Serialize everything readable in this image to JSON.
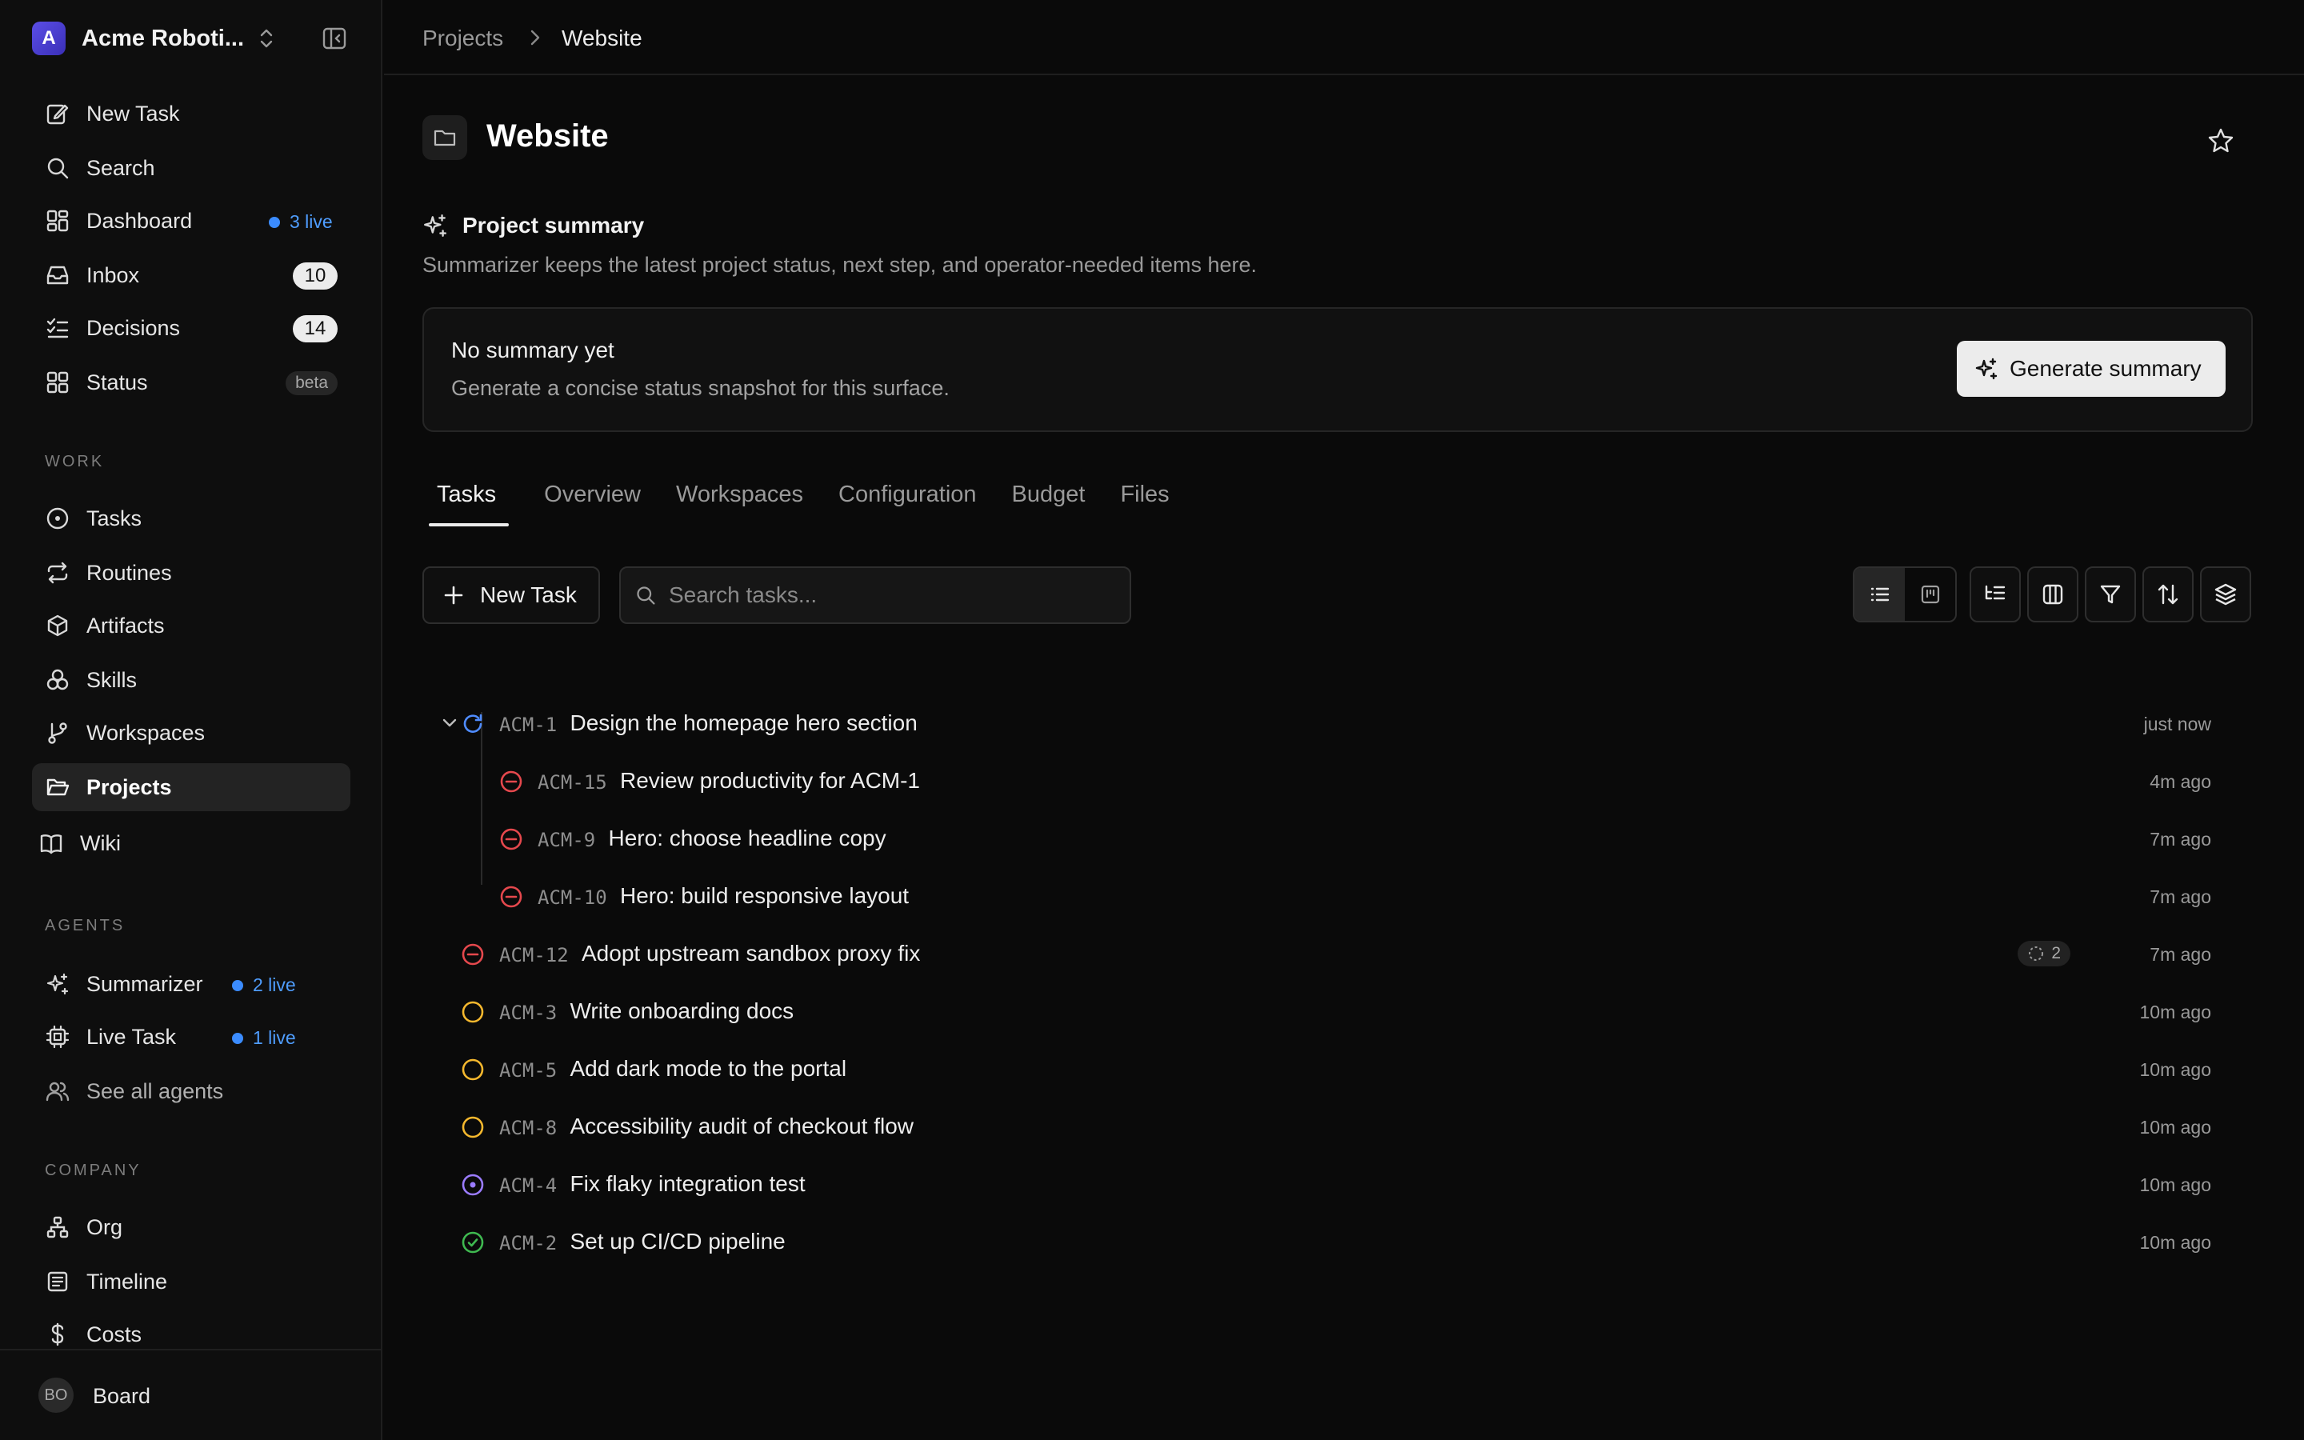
{
  "sidebar": {
    "org_initial": "A",
    "org_name": "Acme Roboti...",
    "items_top": [
      {
        "label": "New Task",
        "icon": "edit-icon"
      },
      {
        "label": "Search",
        "icon": "search-icon"
      },
      {
        "label": "Dashboard",
        "icon": "dashboard-icon",
        "live": "3 live"
      },
      {
        "label": "Inbox",
        "icon": "inbox-icon",
        "count": "10"
      },
      {
        "label": "Decisions",
        "icon": "checklist-icon",
        "count": "14"
      },
      {
        "label": "Status",
        "icon": "grid-icon",
        "tag": "beta"
      }
    ],
    "work_label": "WORK",
    "work_items": [
      {
        "label": "Tasks",
        "icon": "circle-dot-icon"
      },
      {
        "label": "Routines",
        "icon": "repeat-icon"
      },
      {
        "label": "Artifacts",
        "icon": "box-icon"
      },
      {
        "label": "Skills",
        "icon": "skills-icon"
      },
      {
        "label": "Workspaces",
        "icon": "git-branch-icon"
      },
      {
        "label": "Projects",
        "icon": "folder-open-icon",
        "active": true
      },
      {
        "label": "Wiki",
        "icon": "book-icon"
      }
    ],
    "agents_label": "AGENTS",
    "agent_items": [
      {
        "label": "Summarizer",
        "icon": "sparkles-icon",
        "live": "2 live"
      },
      {
        "label": "Live Task",
        "icon": "cpu-icon",
        "live": "1 live"
      },
      {
        "label": "See all agents",
        "icon": "users-icon"
      }
    ],
    "company_label": "COMPANY",
    "company_items": [
      {
        "label": "Org",
        "icon": "org-chart-icon"
      },
      {
        "label": "Timeline",
        "icon": "timeline-icon"
      },
      {
        "label": "Costs",
        "icon": "dollar-icon"
      }
    ],
    "user_initials": "BO",
    "user_label": "Board"
  },
  "breadcrumb": {
    "parent": "Projects",
    "current": "Website"
  },
  "page": {
    "title": "Website",
    "summary_title": "Project summary",
    "summary_desc": "Summarizer keeps the latest project status, next step, and operator-needed items here.",
    "card_heading": "No summary yet",
    "card_sub": "Generate a concise status snapshot for this surface.",
    "generate_label": "Generate summary"
  },
  "tabs": [
    "Tasks",
    "Overview",
    "Workspaces",
    "Configuration",
    "Budget",
    "Files"
  ],
  "active_tab": "Tasks",
  "toolbar": {
    "new_task_label": "New Task",
    "search_placeholder": "Search tasks..."
  },
  "tasks": [
    {
      "id": "ACM-1",
      "title": "Design the homepage hero section",
      "time": "just now",
      "status": "in-progress",
      "expanded": true
    },
    {
      "id": "ACM-15",
      "title": "Review productivity for ACM-1",
      "time": "4m ago",
      "status": "blocked",
      "child": true
    },
    {
      "id": "ACM-9",
      "title": "Hero: choose headline copy",
      "time": "7m ago",
      "status": "blocked",
      "child": true
    },
    {
      "id": "ACM-10",
      "title": "Hero: build responsive layout",
      "time": "7m ago",
      "status": "blocked",
      "child": true
    },
    {
      "id": "ACM-12",
      "title": "Adopt upstream sandbox proxy fix",
      "time": "7m ago",
      "status": "blocked",
      "chip": "2"
    },
    {
      "id": "ACM-3",
      "title": "Write onboarding docs",
      "time": "10m ago",
      "status": "todo"
    },
    {
      "id": "ACM-5",
      "title": "Add dark mode to the portal",
      "time": "10m ago",
      "status": "todo"
    },
    {
      "id": "ACM-8",
      "title": "Accessibility audit of checkout flow",
      "time": "10m ago",
      "status": "todo"
    },
    {
      "id": "ACM-4",
      "title": "Fix flaky integration test",
      "time": "10m ago",
      "status": "in-review"
    },
    {
      "id": "ACM-2",
      "title": "Set up CI/CD pipeline",
      "time": "10m ago",
      "status": "done"
    }
  ],
  "colors": {
    "in-progress": "#4f8cff",
    "blocked": "#e5484d",
    "todo": "#f5b82e",
    "in-review": "#9b7cff",
    "done": "#3fb950",
    "live": "#3b8cff"
  }
}
